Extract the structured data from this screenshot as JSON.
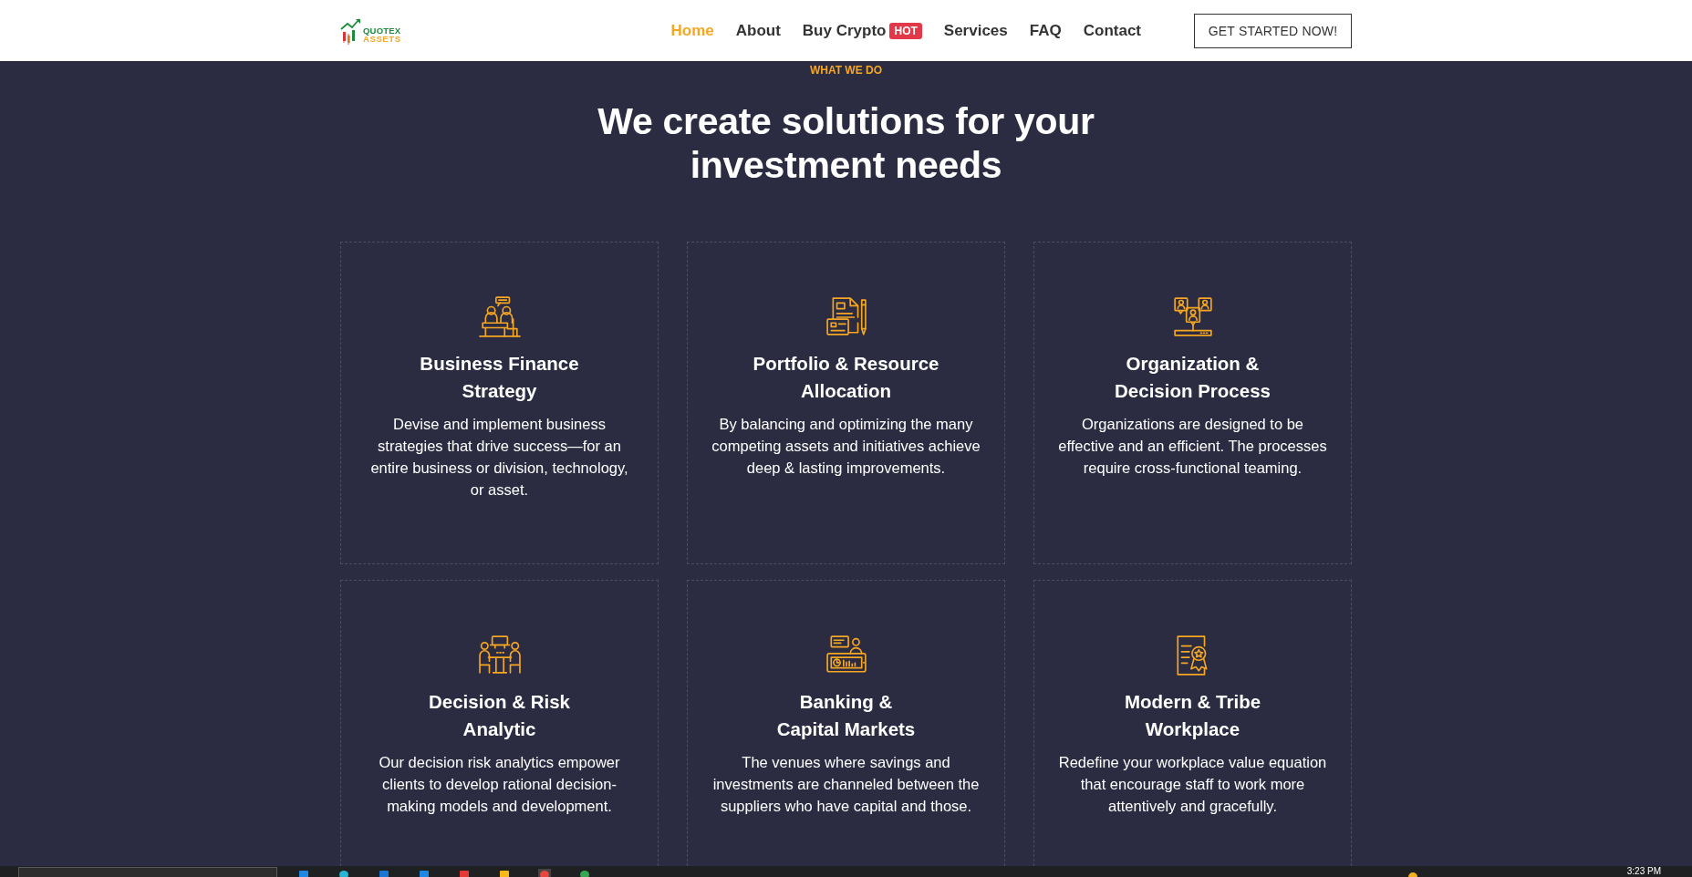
{
  "header": {
    "logo": {
      "line_1": "QUOTEX",
      "line_2": "ASSETS"
    },
    "nav": [
      {
        "label": "Home",
        "selected": true
      },
      {
        "label": "About",
        "selected": false
      },
      {
        "label": "Buy Crypto",
        "selected": false,
        "badge": "HOT"
      },
      {
        "label": "Services",
        "selected": false
      },
      {
        "label": "FAQ",
        "selected": false
      },
      {
        "label": "Contact",
        "selected": false
      }
    ],
    "cta": "GET STARTED NOW!"
  },
  "section": {
    "eyebrow": "WHAT WE DO",
    "heading_lines": [
      "We create solutions for your",
      "investment needs"
    ],
    "cards": [
      {
        "kind": "desk_meeting",
        "title_lines": [
          "Business Finance",
          "Strategy"
        ],
        "text": "Devise and implement business strategies that drive success—for an entire business or division, technology, or asset."
      },
      {
        "kind": "documents",
        "title_lines": [
          "Portfolio & Resource",
          "Allocation"
        ],
        "text": "By balancing and optimizing the many competing assets and initiatives achieve deep & lasting improvements."
      },
      {
        "kind": "people_board",
        "title_lines": [
          "Organization &",
          "Decision Process"
        ],
        "text": "Organizations are designed to be effective and an efficient. The processes require cross-functional teaming."
      },
      {
        "kind": "table_meeting",
        "title_lines": [
          "Decision & Risk",
          "Analytic"
        ],
        "text": "Our decision risk analytics empower clients to develop rational decision-making models and development."
      },
      {
        "kind": "monitor",
        "title_lines": [
          "Banking &",
          "Capital Markets"
        ],
        "text": "The venues where savings and investments are channeled between the suppliers who have capital and those."
      },
      {
        "kind": "certificate",
        "title_lines": [
          "Modern & Tribe",
          "Workplace"
        ],
        "text": "Redefine your workplace value equation that encourage staff to work more attentively and gracefully."
      }
    ]
  },
  "taskbar": {
    "time": "3:23 PM"
  }
}
